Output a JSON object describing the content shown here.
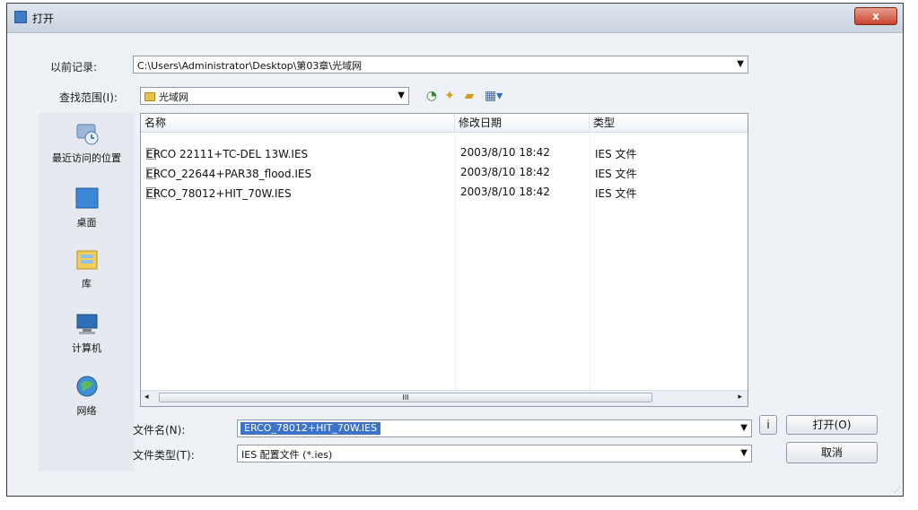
{
  "window": {
    "title": "打开",
    "close_label": "x"
  },
  "history": {
    "label": "以前记录:",
    "value": "C:\\Users\\Administrator\\Desktop\\第03章\\光域网"
  },
  "lookin": {
    "label": "查找范围(I):",
    "value": "光域网"
  },
  "toolbar_icons": [
    "back-icon",
    "up-folder-icon",
    "new-folder-icon",
    "view-menu-icon"
  ],
  "places": [
    {
      "name": "recent-places-icon",
      "label": "最近访问的位置"
    },
    {
      "name": "desktop-icon",
      "label": "桌面"
    },
    {
      "name": "libraries-icon",
      "label": "库"
    },
    {
      "name": "computer-icon",
      "label": "计算机"
    },
    {
      "name": "network-icon",
      "label": "网络"
    }
  ],
  "columns": [
    "名称",
    "修改日期",
    "类型"
  ],
  "files": [
    {
      "name": "ERCO 22111+TC-DEL 13W.IES",
      "date": "2003/8/10 18:42",
      "type": "IES 文件"
    },
    {
      "name": "ERCO_22644+PAR38_flood.IES",
      "date": "2003/8/10 18:42",
      "type": "IES 文件"
    },
    {
      "name": "ERCO_78012+HIT_70W.IES",
      "date": "2003/8/10 18:42",
      "type": "IES 文件"
    }
  ],
  "scroll_center": "III",
  "filename": {
    "label": "文件名(N):",
    "value": "ERCO_78012+HIT_70W.IES"
  },
  "filetype": {
    "label": "文件类型(T):",
    "value": "IES 配置文件 (*.ies)"
  },
  "buttons": {
    "info": "i",
    "open": "打开(O)",
    "cancel": "取消"
  }
}
